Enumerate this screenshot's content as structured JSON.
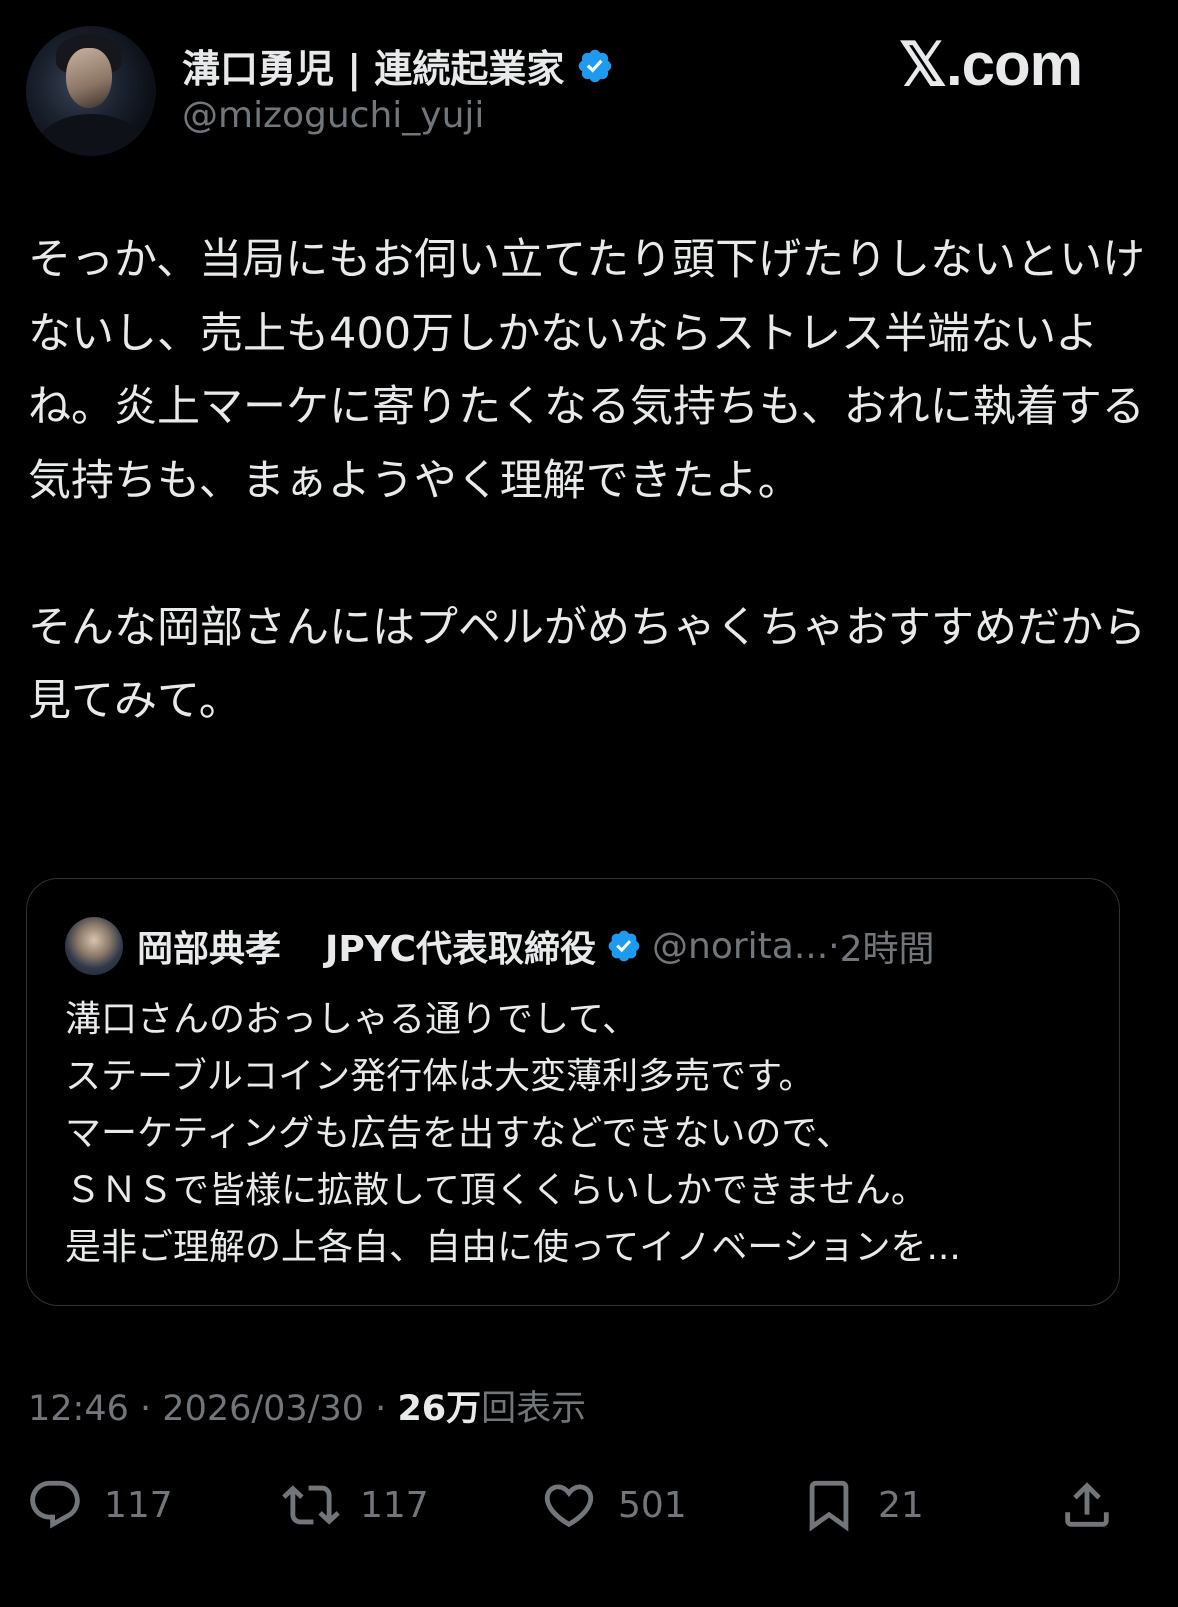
{
  "brand": "𝕏.com",
  "author": {
    "display_name": "溝口勇児 | 連続起業家",
    "handle": "@mizoguchi_yuji",
    "verified": true
  },
  "tweet": {
    "paragraphs": [
      "そっか、当局にもお伺い立てたり頭下げたりしないといけないし、売上も400万しかないならストレス半端ないよね。炎上マーケに寄りたくなる気持ちも、おれに執着する気持ちも、まぁようやく理解できたよ。",
      "そんな岡部さんにはプペルがめちゃくちゃおすすめだから見てみて。"
    ]
  },
  "quoted_tweet": {
    "name_part1": "岡部典孝",
    "name_part2": "JPYC代表取締役",
    "handle": "@norita...",
    "separator": "·",
    "time": "2時間",
    "lines": [
      "溝口さんのおっしゃる通りでして、",
      "ステーブルコイン発行体は大変薄利多売です。",
      "マーケティングも広告を出すなどできないので、",
      "ＳＮＳで皆様に拡散して頂くくらいしかできません。",
      "是非ご理解の上各自、自由に使ってイノベーションを..."
    ]
  },
  "meta": {
    "time": "12:46",
    "date": "2026/03/30",
    "separator": "·",
    "views_count": "26万",
    "views_label": "回表示"
  },
  "actions": {
    "replies": "117",
    "reposts": "117",
    "likes": "501",
    "bookmarks": "21"
  },
  "colors": {
    "background": "#000000",
    "text": "#e7e9ea",
    "secondary": "#71767b",
    "verified": "#1d9bf0",
    "border": "#2f3336"
  }
}
